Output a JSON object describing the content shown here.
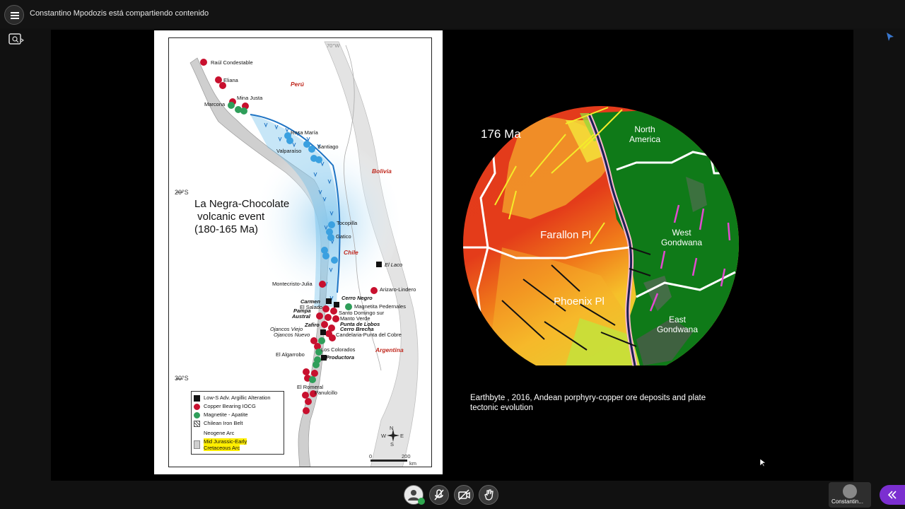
{
  "header": {
    "share_text": "Constantino Mpodozis está compartiendo contenido",
    "menu_icon": "hamburger-menu-icon",
    "side_icon": "search-panel-icon"
  },
  "map": {
    "longitude_label": "70°W",
    "lat_20": "20°S",
    "lat_30": "30°S",
    "countries": {
      "peru": "Perú",
      "bolivia": "Bolivia",
      "chile": "Chile",
      "argentina": "Argentina"
    },
    "event_title": [
      "La Negra-Chocolate",
      " volcanic event",
      "(180-165 Ma)"
    ],
    "deposits": [
      "Raúl Condestable",
      "Eliana",
      "Mina Justa",
      "Marcona",
      "Rosa María",
      "Santiago",
      "Valparaíso",
      "Tocopilla",
      "Gatico",
      "El Laco",
      "Montecristo-Julia",
      "Arizaro-Lindero",
      "Carmen",
      "El Salado",
      "Cerro Negro",
      "Magnetita Pedernales",
      "Pampa",
      "Austral",
      "Santo Domingo sur",
      "Manto Verde",
      "Punta de Lobos",
      "Zafiro",
      "Ojancos Viejo",
      "Ojancos Nuevo",
      "Cerro Brecha",
      "Candelaria-Punta del Cobre",
      "Los Colorados",
      "El Algarrobo",
      "Productora",
      "El Romeral",
      "Panulcillo"
    ],
    "legend": [
      "Low-S Adv. Argillic Alteration",
      "Copper Bearing IOCG",
      "Magnetite - Apatite",
      "Chilean Iron Belt",
      "Neogene Arc",
      "Mid Jurassic-Early",
      "Cretaceous Arc"
    ],
    "scale_0": "0",
    "scale_200": "200",
    "scale_unit": "km",
    "compass": {
      "n": "N",
      "s": "S",
      "e": "E",
      "w": "W"
    }
  },
  "globe": {
    "age": "176 Ma",
    "plates": {
      "north_america": [
        "North",
        "America"
      ],
      "farallon": "Farallon Pl",
      "west_gondwana": [
        "West",
        "Gondwana"
      ],
      "phoenix": "Phoenix Pl",
      "east_gondwana": [
        "East",
        "Gondwana"
      ]
    }
  },
  "caption": "Earthbyte , 2016, Andean porphyry-copper ore deposits and plate tectonic evolution",
  "footer": {
    "participant_name": "Constantin...",
    "controls": [
      "avatar-icon",
      "mic-off-icon",
      "camera-off-icon",
      "hand-raise-icon"
    ],
    "collapse_icon": "chevron-left-icon"
  },
  "colors": {
    "accent": "#7b2fd0",
    "status_green": "#2fa84f",
    "iocg_red": "#c8102e",
    "magnetite_green": "#2f9e5a",
    "arc_blue": "#3aa0e0"
  }
}
